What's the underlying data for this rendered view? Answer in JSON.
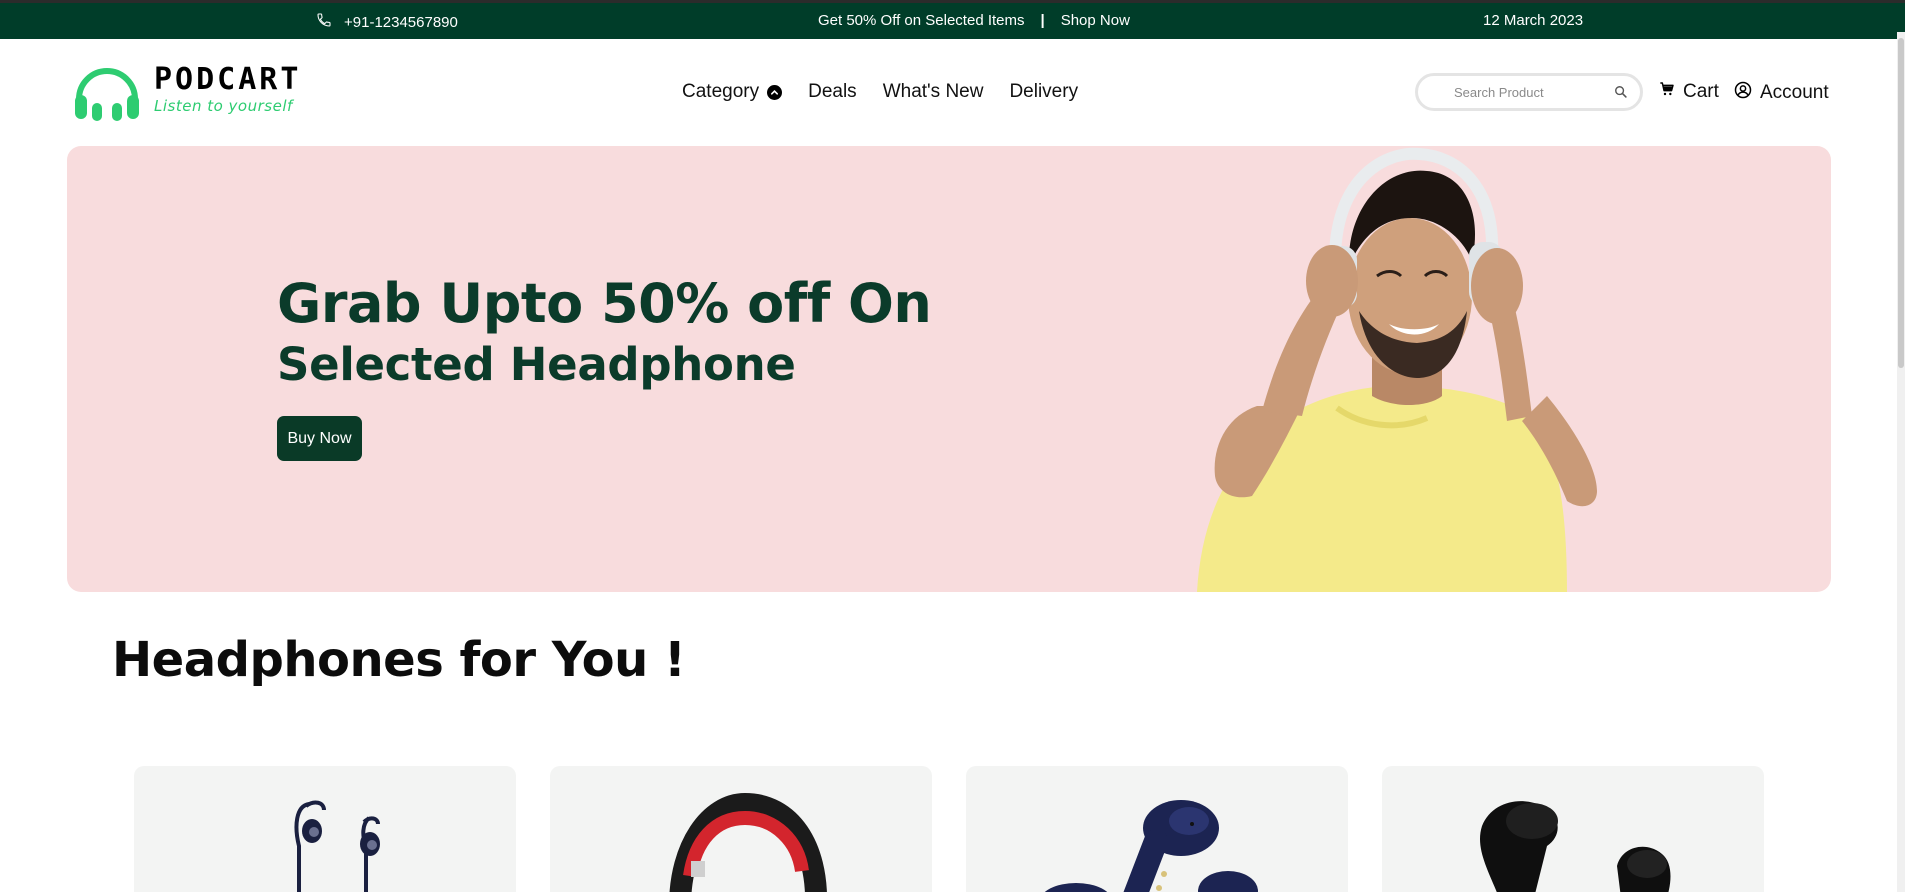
{
  "topbar": {
    "phone": "+91-1234567890",
    "phone_icon": "phone-icon",
    "promo_text": "Get 50% Off on Selected Items",
    "separator": "|",
    "promo_link": "Shop Now",
    "date": "12 March 2023"
  },
  "brand": {
    "name": "PODCART",
    "tagline": "Listen to yourself",
    "logo_icon": "headphones-icon",
    "accent": "#2ecc71"
  },
  "nav": {
    "items": [
      {
        "label": "Category",
        "has_dropdown": true
      },
      {
        "label": "Deals"
      },
      {
        "label": "What's New"
      },
      {
        "label": "Delivery"
      }
    ]
  },
  "search": {
    "placeholder": "Search Product",
    "value": ""
  },
  "header_actions": {
    "cart_label": "Cart",
    "account_label": "Account"
  },
  "hero": {
    "headline": "Grab Upto 50% off On",
    "subheadline": "Selected Headphone",
    "cta_label": "Buy Now",
    "background": "#f8dcdd",
    "text_color": "#0b3b2a"
  },
  "section": {
    "title": "Headphones for You !"
  },
  "products": [
    {
      "image": "wireless-earphones"
    },
    {
      "image": "over-ear-headphone"
    },
    {
      "image": "blue-earbuds"
    },
    {
      "image": "black-earbuds"
    }
  ],
  "colors": {
    "topbar_bg": "#003d29",
    "button_bg": "#0a3a27",
    "card_bg": "#f3f4f3"
  }
}
